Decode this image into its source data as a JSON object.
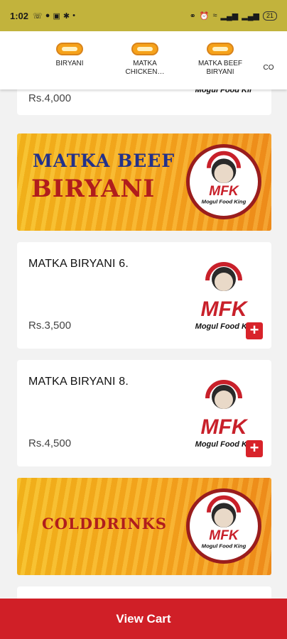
{
  "status_bar": {
    "time": "1:02",
    "battery": "21"
  },
  "categories": [
    {
      "label": "BIRYANI"
    },
    {
      "label": "MATKA\nCHICKEN…"
    },
    {
      "label": "MATKA BEEF\nBIRYANI"
    },
    {
      "label": "CO"
    }
  ],
  "items": [
    {
      "price": "Rs.4,000"
    },
    {
      "name": "MATKA BIRYANI 6.",
      "price": "Rs.3,500"
    },
    {
      "name": "MATKA BIRYANI 8.",
      "price": "Rs.4,500"
    }
  ],
  "banners": {
    "beef_line1": "MATKA BEEF",
    "beef_line2": "BIRYANI",
    "colddrinks": "COLDDRINKS"
  },
  "logo": {
    "brand": "MFK",
    "tagline": "Mogul Food King",
    "tagline_cropped": "Mogul Food Kir"
  },
  "add_symbol": "+",
  "view_cart": "View Cart",
  "colors": {
    "status_bar": "#c2b33c",
    "accent_red": "#d01f27",
    "banner_orange": "#f6a61c",
    "banner_blue": "#23318a"
  }
}
